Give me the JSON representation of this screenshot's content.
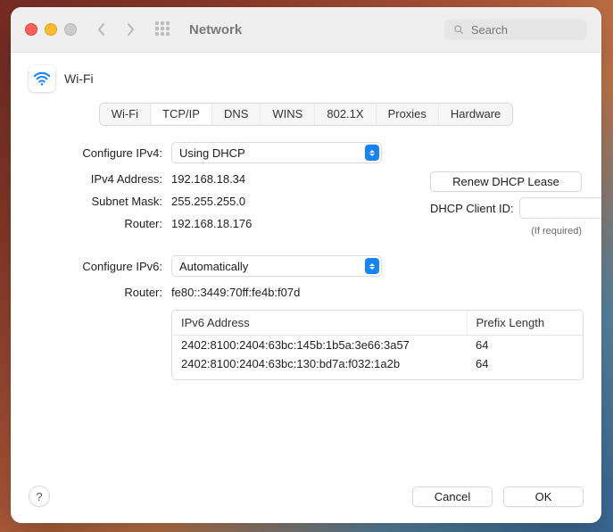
{
  "window": {
    "title": "Network",
    "search_placeholder": "Search"
  },
  "sheet": {
    "title": "Wi-Fi"
  },
  "tabs": [
    "Wi-Fi",
    "TCP/IP",
    "DNS",
    "WINS",
    "802.1X",
    "Proxies",
    "Hardware"
  ],
  "active_tab": "TCP/IP",
  "ipv4": {
    "configure_label": "Configure IPv4:",
    "configure_value": "Using DHCP",
    "address_label": "IPv4 Address:",
    "address_value": "192.168.18.34",
    "subnet_label": "Subnet Mask:",
    "subnet_value": "255.255.255.0",
    "router_label": "Router:",
    "router_value": "192.168.18.176",
    "renew_button": "Renew DHCP Lease",
    "dhcp_client_label": "DHCP Client ID:",
    "dhcp_client_value": "",
    "dhcp_note": "(If required)"
  },
  "ipv6": {
    "configure_label": "Configure IPv6:",
    "configure_value": "Automatically",
    "router_label": "Router:",
    "router_value": "fe80::3449:70ff:fe4b:f07d",
    "table_headers": {
      "addr": "IPv6 Address",
      "prefix": "Prefix Length"
    },
    "rows": [
      {
        "addr": "2402:8100:2404:63bc:145b:1b5a:3e66:3a57",
        "prefix": "64"
      },
      {
        "addr": "2402:8100:2404:63bc:130:bd7a:f032:1a2b",
        "prefix": "64"
      }
    ]
  },
  "footer": {
    "help": "?",
    "cancel": "Cancel",
    "ok": "OK"
  }
}
